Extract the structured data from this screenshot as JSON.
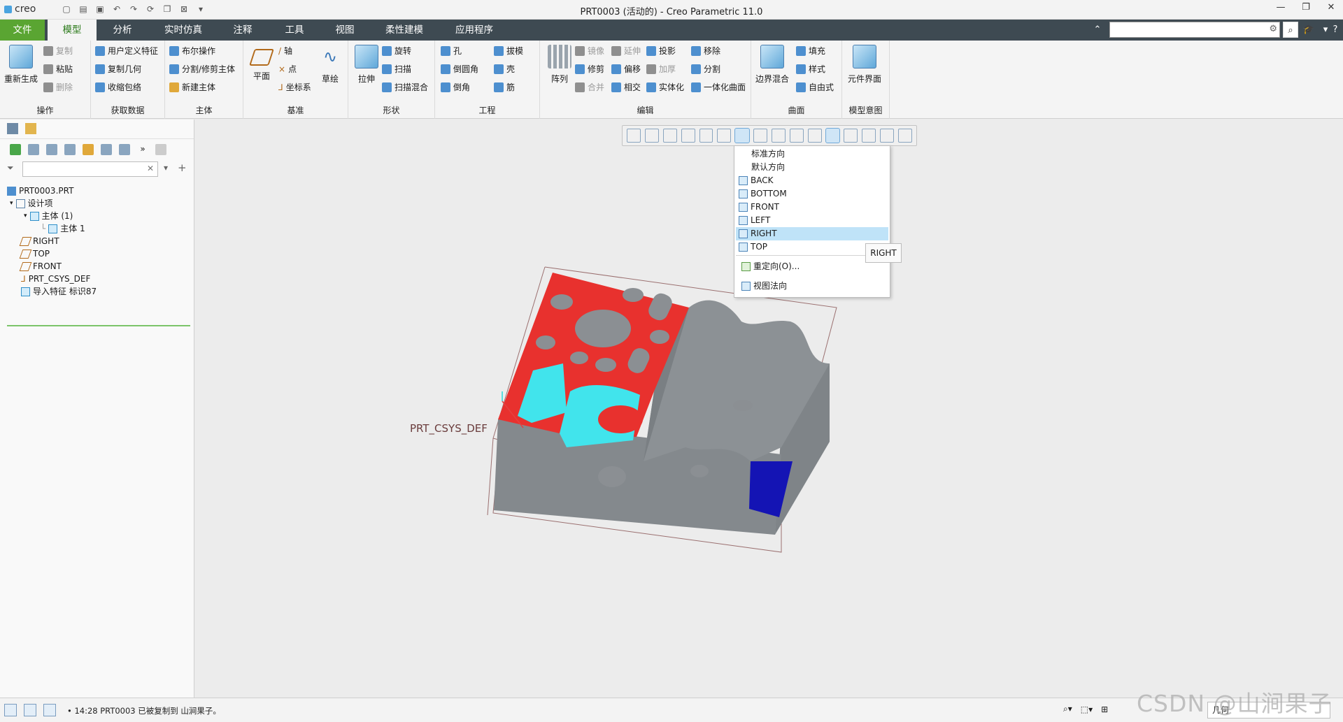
{
  "app": {
    "logo_text": "creo",
    "window_title": "PRT0003 (活动的) - Creo Parametric 11.0",
    "win_minimize": "—",
    "win_restore": "❐",
    "win_close": "✕"
  },
  "tabs": [
    {
      "label": "文件"
    },
    {
      "label": "模型"
    },
    {
      "label": "分析"
    },
    {
      "label": "实时仿真"
    },
    {
      "label": "注释"
    },
    {
      "label": "工具"
    },
    {
      "label": "视图"
    },
    {
      "label": "柔性建模"
    },
    {
      "label": "应用程序"
    }
  ],
  "ribbon": {
    "operations": {
      "regenerate": "重新生成",
      "copy": "复制",
      "paste": "粘贴",
      "delete": "删除",
      "group": "操作"
    },
    "get_data": {
      "udf": "用户定义特征",
      "copy_geom": "复制几何",
      "shrinkwrap": "收缩包络",
      "group": "获取数据"
    },
    "body": {
      "boolean": "布尔操作",
      "split": "分割/修剪主体",
      "new_body": "新建主体",
      "group": "主体"
    },
    "datum": {
      "plane": "平面",
      "axis": "轴",
      "point": "点",
      "csys": "坐标系",
      "sketch": "草绘",
      "group": "基准"
    },
    "shapes": {
      "extrude": "拉伸",
      "revolve": "旋转",
      "sweep": "扫描",
      "swept_blend": "扫描混合",
      "group": "形状"
    },
    "engineering": {
      "hole": "孔",
      "round": "倒圆角",
      "chamfer": "倒角",
      "draft": "拔模",
      "shell": "壳",
      "rib": "筋",
      "group": "工程"
    },
    "editing": {
      "pattern": "阵列",
      "mirror": "镜像",
      "trim": "修剪",
      "merge": "合并",
      "extend": "延伸",
      "offset": "偏移",
      "intersect": "相交",
      "project": "投影",
      "thicken": "加厚",
      "solidify": "实体化",
      "remove": "移除",
      "split": "分割",
      "unify": "一体化曲面",
      "group": "编辑"
    },
    "surfaces": {
      "boundary": "边界混合",
      "fill": "填充",
      "style": "样式",
      "freestyle": "自由式",
      "group": "曲面"
    },
    "model_intent": {
      "component_interface": "元件界面",
      "group": "模型意图"
    }
  },
  "tree": {
    "root": "PRT0003.PRT",
    "design_items": "设计项",
    "bodies": "主体 (1)",
    "body1": "主体 1",
    "right": "RIGHT",
    "top": "TOP",
    "front": "FRONT",
    "csys": "PRT_CSYS_DEF",
    "import": "导入特征 标识87"
  },
  "view_menu": {
    "standard": "标准方向",
    "default": "默认方向",
    "back": "BACK",
    "bottom": "BOTTOM",
    "front": "FRONT",
    "left": "LEFT",
    "right": "RIGHT",
    "top": "TOP",
    "reorient": "重定向(O)...",
    "normal": "视图法向",
    "tooltip": "RIGHT"
  },
  "graphics": {
    "csys_label": "PRT_CSYS_DEF",
    "colors": {
      "red_face": "#e8312e",
      "cyan_face": "#41e4ec",
      "blue_face": "#1414b4",
      "body_gray": "#8b8f93"
    }
  },
  "status": {
    "message": "• 14:28 PRT0003 已被复制到 山涧果子。",
    "geometry": "几何",
    "watermark": "CSDN @山涧果子"
  }
}
